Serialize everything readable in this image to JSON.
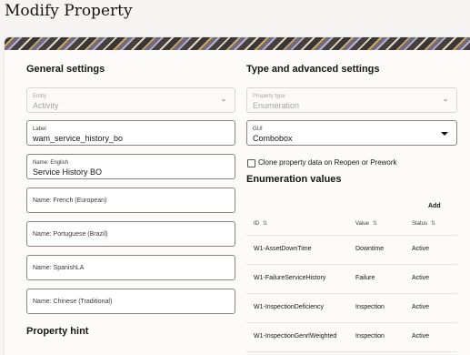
{
  "page": {
    "title": "Modify Property"
  },
  "left": {
    "section_title": "General settings",
    "entity": {
      "label": "Entity",
      "value": "Activity"
    },
    "label_field": {
      "label": "Label",
      "value": "wam_service_history_bo"
    },
    "name_english": {
      "label": "Name: English",
      "value": "Service History BO"
    },
    "name_french": {
      "placeholder": "Name: French (European)"
    },
    "name_portuguese": {
      "placeholder": "Name: Portuguese (Brazil)"
    },
    "name_spanish": {
      "placeholder": "Name: SpanishLA"
    },
    "name_chinese": {
      "placeholder": "Name: Chinese (Traditional)"
    },
    "hint_title": "Property hint"
  },
  "right": {
    "section_title": "Type and advanced settings",
    "property_type": {
      "label": "Property type",
      "value": "Enumeration"
    },
    "gui": {
      "label": "GUI",
      "value": "Combobox"
    },
    "clone_label": "Clone property data on Reopen or Prework",
    "enum_title": "Enumeration values",
    "add_label": "Add",
    "table": {
      "headers": {
        "id": "ID",
        "value": "Value",
        "status": "Status"
      },
      "rows": [
        {
          "id": "W1-AssetDownTime",
          "value": "Downtime",
          "status": "Active"
        },
        {
          "id": "W1-FailureServiceHistory",
          "value": "Failure",
          "status": "Active"
        },
        {
          "id": "W1-InspectionDeficiency",
          "value": "Inspection",
          "status": "Active"
        },
        {
          "id": "W1-InspectionGenrlWeighted",
          "value": "Inspection",
          "status": "Active"
        }
      ]
    }
  },
  "icons": {
    "sort": "sort-arrows-icon",
    "dropdown": "chevron-down-icon"
  }
}
